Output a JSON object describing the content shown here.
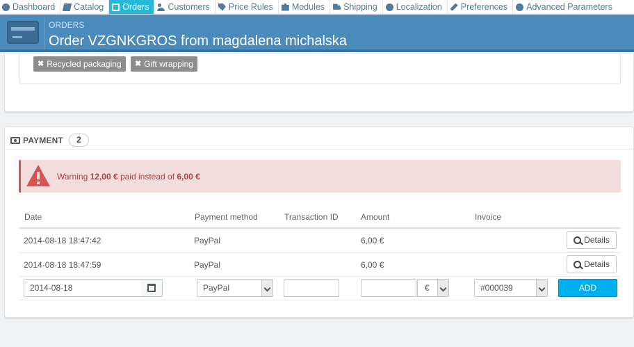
{
  "nav": {
    "items": [
      {
        "label": "Dashboard",
        "icon": "dashboard-icon"
      },
      {
        "label": "Catalog",
        "icon": "book-icon"
      },
      {
        "label": "Orders",
        "icon": "orders-icon"
      },
      {
        "label": "Customers",
        "icon": "users-icon"
      },
      {
        "label": "Price Rules",
        "icon": "tag-icon"
      },
      {
        "label": "Modules",
        "icon": "puzzle-icon"
      },
      {
        "label": "Shipping",
        "icon": "truck-icon"
      },
      {
        "label": "Localization",
        "icon": "globe-icon"
      },
      {
        "label": "Preferences",
        "icon": "wrench-icon"
      },
      {
        "label": "Advanced Parameters",
        "icon": "gears-icon"
      }
    ],
    "active": "Orders",
    "active_color": "#25b9d7"
  },
  "header": {
    "breadcrumb": "ORDERS",
    "title": "Order VZGNKGROS from magdalena michalska",
    "bg_color": "#4a8bbc"
  },
  "tags": [
    {
      "label": "Recycled packaging"
    },
    {
      "label": "Gift wrapping"
    }
  ],
  "payment": {
    "heading": "PAYMENT",
    "count": "2",
    "warning": {
      "prefix": "Warning",
      "paid": "12,00 €",
      "middle": "paid instead of",
      "expected": "6,00 €"
    },
    "columns": [
      "Date",
      "Payment method",
      "Transaction ID",
      "Amount",
      "Invoice"
    ],
    "rows": [
      {
        "date": "2014-08-18 18:47:42",
        "method": "PayPal",
        "transaction_id": "",
        "amount": "6,00 €",
        "invoice": "",
        "action": "Details"
      },
      {
        "date": "2014-08-18 18:47:59",
        "method": "PayPal",
        "transaction_id": "",
        "amount": "6,00 €",
        "invoice": "",
        "action": "Details"
      }
    ],
    "form": {
      "date": "2014-08-18",
      "method": "PayPal",
      "transaction_id": "",
      "amount": "",
      "currency": "€",
      "invoice": "#000039",
      "add_label": "ADD"
    },
    "alert_color": "#f3dcdc",
    "add_color": "#00aff0"
  }
}
